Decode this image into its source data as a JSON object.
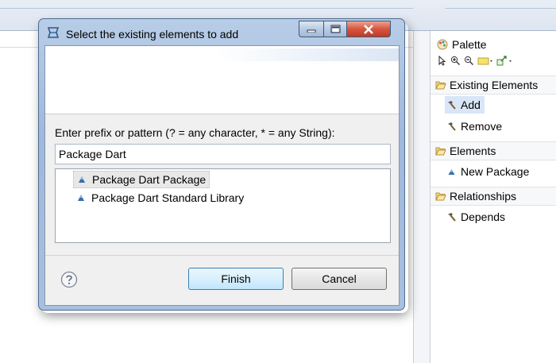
{
  "dialog": {
    "title": "Select the existing elements to add",
    "prompt": "Enter prefix or pattern (? = any character, * = any String):",
    "pattern_value": "Package Dart",
    "results": [
      {
        "label": "Package Dart Package",
        "selected": true
      },
      {
        "label": "Package Dart Standard Library",
        "selected": false
      }
    ],
    "finish_label": "Finish",
    "cancel_label": "Cancel"
  },
  "palette": {
    "title": "Palette",
    "drawers": [
      {
        "label": "Existing Elements",
        "entries": [
          {
            "label": "Add",
            "icon": "hammer-icon",
            "selected": true
          },
          {
            "label": "Remove",
            "icon": "hammer-icon",
            "selected": false
          }
        ]
      },
      {
        "label": "Elements",
        "entries": [
          {
            "label": "New Package",
            "icon": "package-triangle-icon",
            "selected": false
          }
        ]
      },
      {
        "label": "Relationships",
        "entries": [
          {
            "label": "Depends",
            "icon": "hammer-icon",
            "selected": false
          }
        ]
      }
    ]
  },
  "colors": {
    "dialog_frame": "#a8c0df",
    "close_button": "#d7553e",
    "default_button": "#bee6fd",
    "selection": "#d8e6f7",
    "package_icon": "#3a6fa8"
  }
}
